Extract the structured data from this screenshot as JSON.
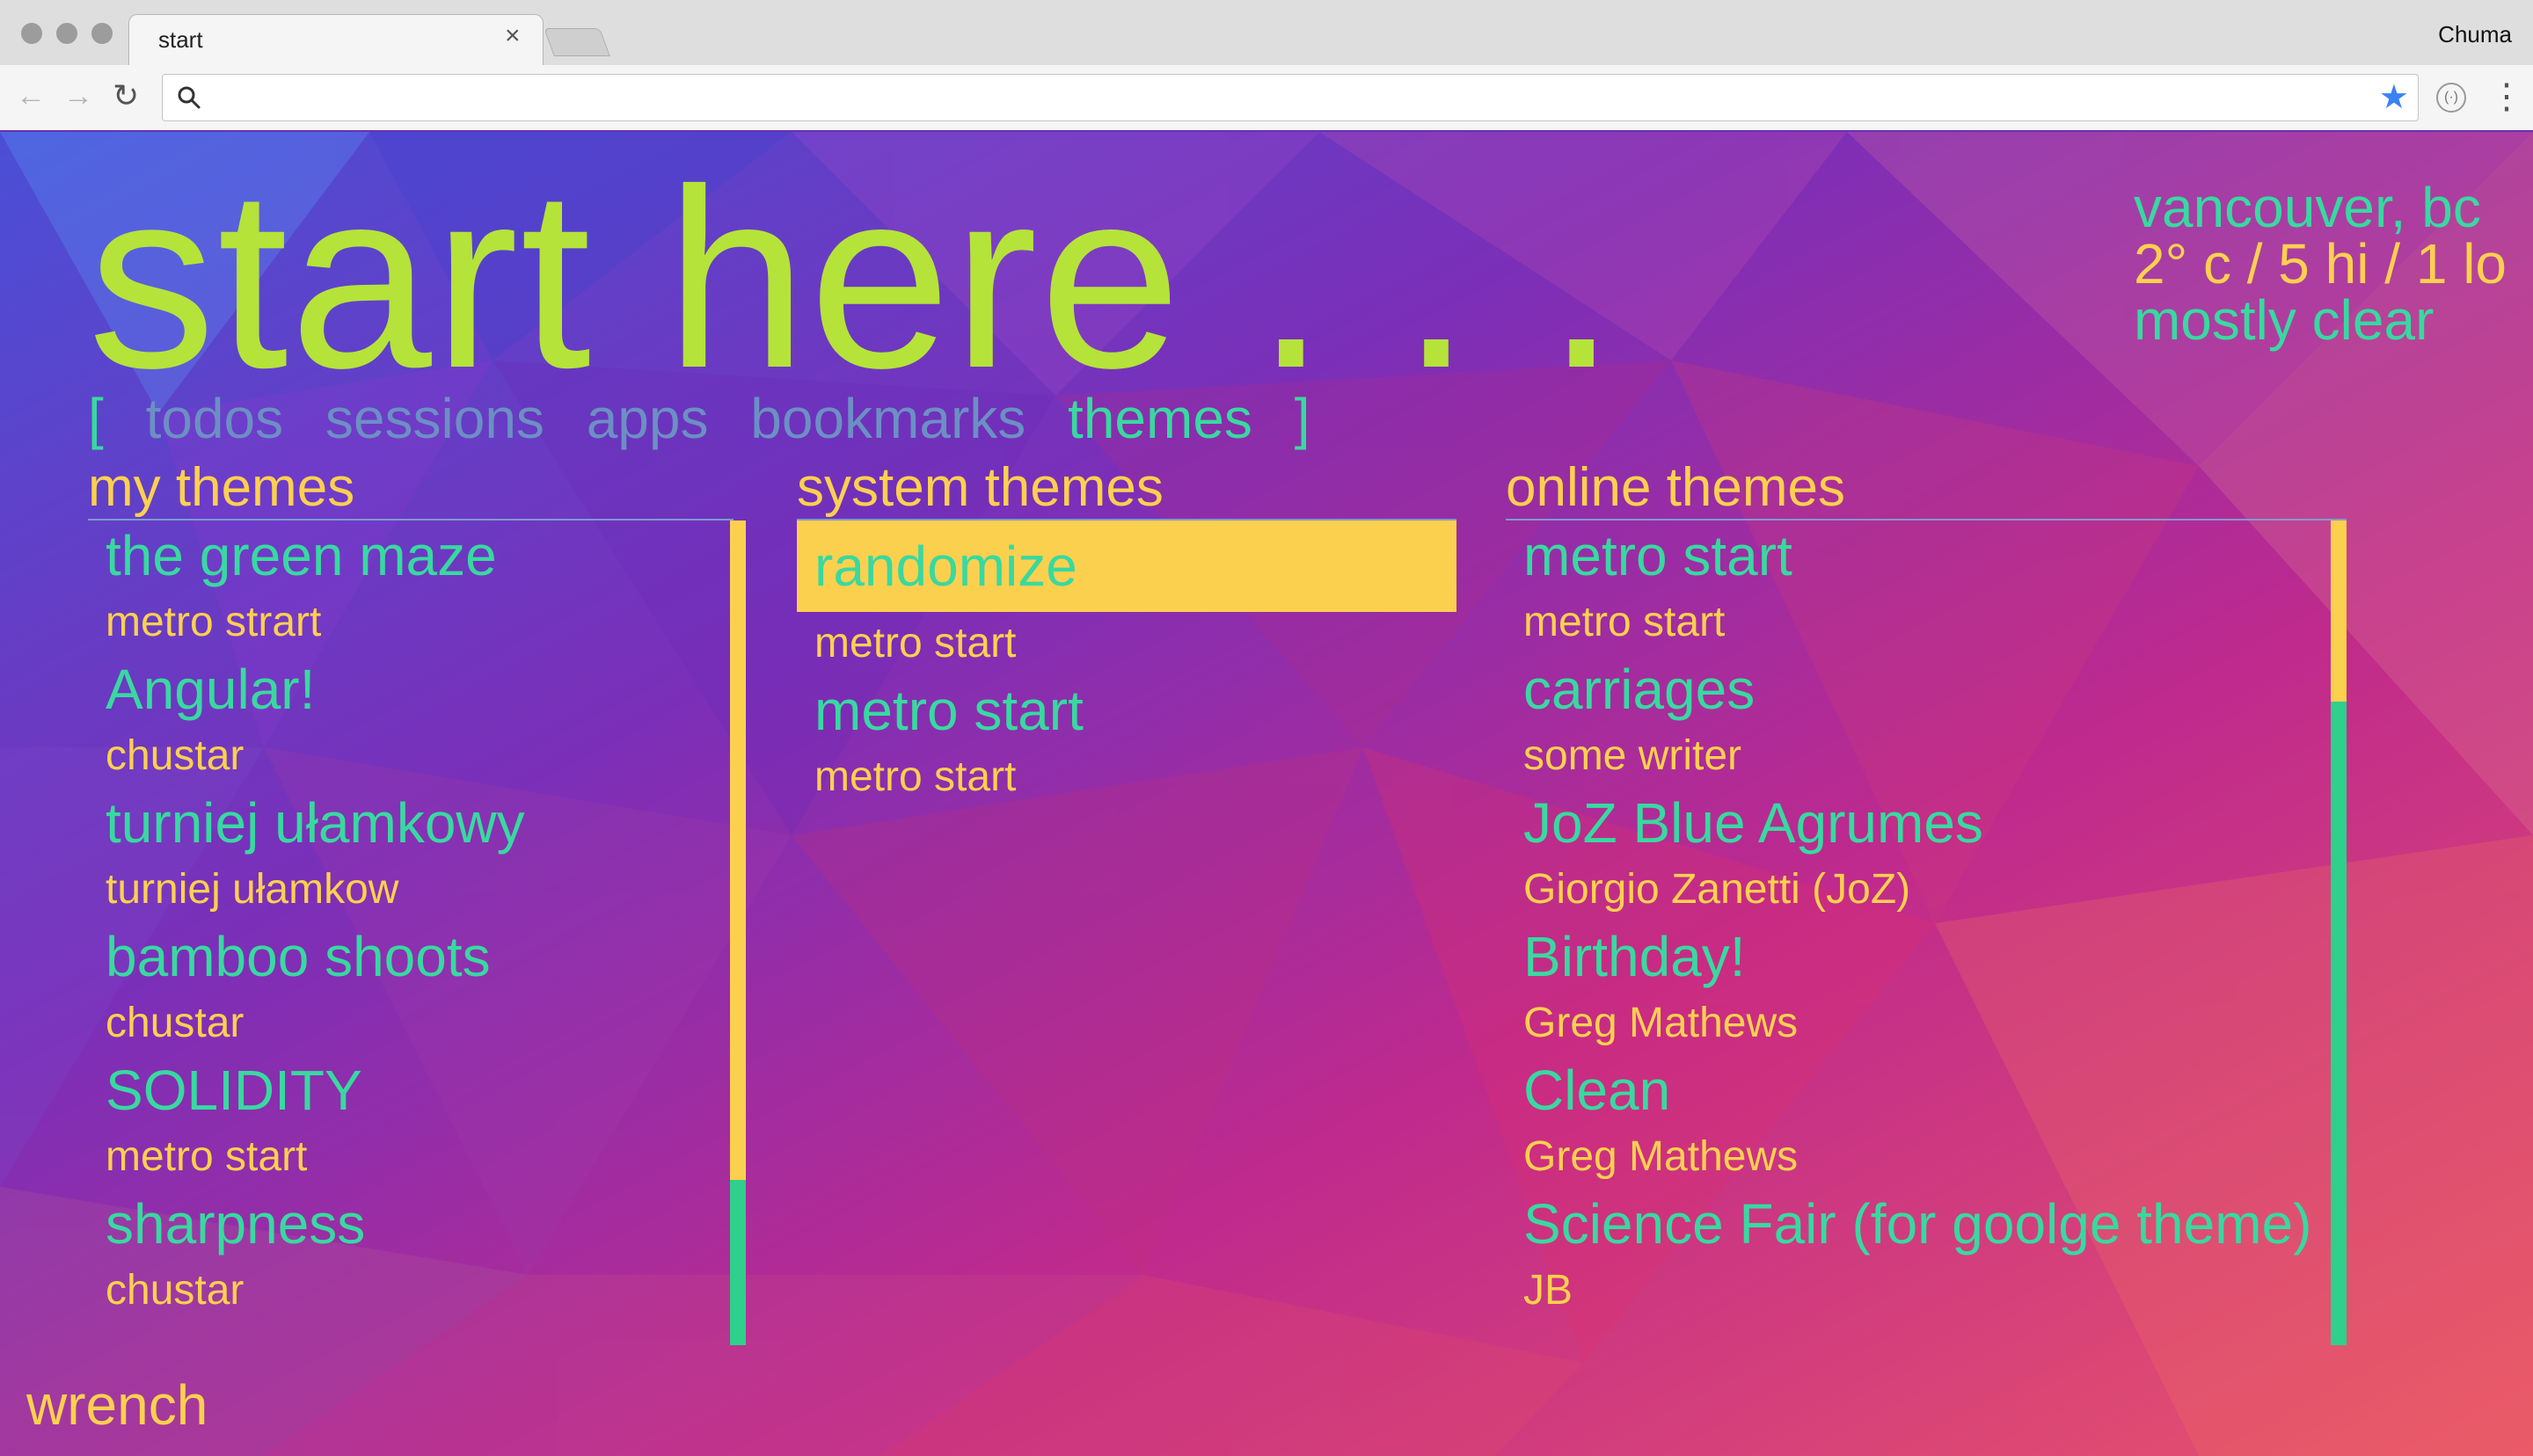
{
  "browser": {
    "tab_title": "start",
    "tab_close": "×",
    "profile_name": "Chuma",
    "back_icon": "arrow-left",
    "forward_icon": "arrow-right",
    "reload_icon": "reload",
    "search_icon": "magnifier",
    "bookmark_icon": "star",
    "omnibox_value": "",
    "colors": {
      "chrome": "#dedede",
      "toolbar": "#f5f5f5",
      "star": "#3b82f6"
    }
  },
  "page": {
    "headline": "start here . . .",
    "weather": {
      "location": "vancouver, bc",
      "temp_text": "2° c / 5 hi / 1 lo",
      "condition": "mostly clear"
    },
    "nav": {
      "open_bracket": "[",
      "items": [
        "todos",
        "sessions",
        "apps",
        "bookmarks",
        "themes"
      ],
      "active": "themes",
      "close_bracket": "]"
    },
    "columns": {
      "my_themes": {
        "title": "my themes",
        "items": [
          {
            "name": "the green maze",
            "author": "metro strart"
          },
          {
            "name": "Angular!",
            "author": "chustar"
          },
          {
            "name": "turniej ułamkowy",
            "author": "turniej ułamkow"
          },
          {
            "name": "bamboo shoots",
            "author": "chustar"
          },
          {
            "name": "SOLIDITY",
            "author": "metro start"
          },
          {
            "name": "sharpness",
            "author": "chustar"
          }
        ],
        "scroll_fraction_visible": 0.8
      },
      "system_themes": {
        "title": "system themes",
        "items": [
          {
            "name": "randomize",
            "author": "metro start",
            "selected": true
          },
          {
            "name": "metro start",
            "author": "metro start",
            "selected": false
          }
        ]
      },
      "online_themes": {
        "title": "online themes",
        "items": [
          {
            "name": "metro start",
            "author": "metro start"
          },
          {
            "name": "carriages",
            "author": "some writer"
          },
          {
            "name": "JoZ Blue Agrumes",
            "author": "Giorgio Zanetti (JoZ)"
          },
          {
            "name": "Birthday!",
            "author": "Greg Mathews"
          },
          {
            "name": "Clean",
            "author": "Greg Mathews"
          },
          {
            "name": "Science Fair (for goolge theme)",
            "author": "JB"
          }
        ],
        "scroll_fraction_visible": 0.22
      }
    },
    "footer": {
      "wrench": "wrench"
    },
    "colors": {
      "headline": "#b5e33a",
      "weather_location": "#38d9a0",
      "weather_temp": "#fcd04f",
      "weather_condition": "#38d9a0",
      "nav_inactive": "#6c8fc4",
      "nav_active": "#38d9a0",
      "bracket": "#38d9a0",
      "column_title": "#fcd04f",
      "entry_name": "#38d9a0",
      "entry_author": "#fcd04f",
      "selected_bg": "#fcd04f",
      "scroll_track": "#fcd04f",
      "scroll_thumb": "#2fcf8c",
      "wrench": "#fcd04f"
    }
  }
}
